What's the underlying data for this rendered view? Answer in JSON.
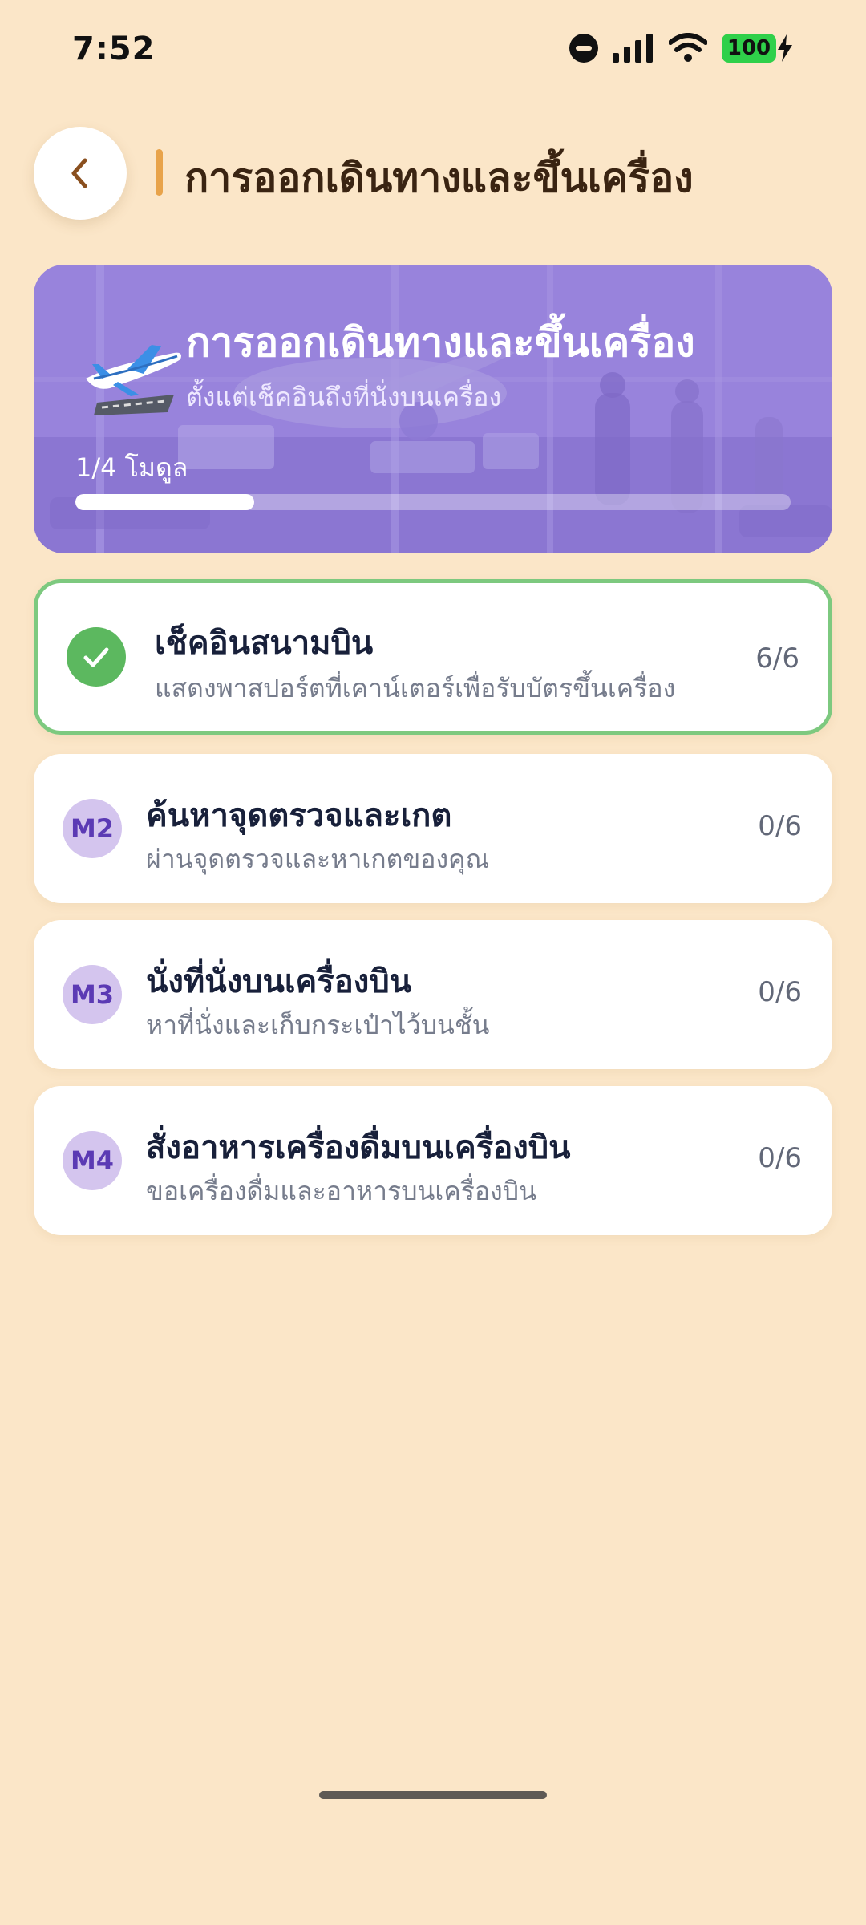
{
  "status_bar": {
    "time": "7:52",
    "battery": "100",
    "icons": [
      "do-not-disturb-icon",
      "signal-icon",
      "wifi-icon",
      "battery-icon",
      "charging-bolt-icon"
    ]
  },
  "header": {
    "back_icon": "chevron-left-icon",
    "title": "การออกเดินทางและขึ้นเครื่อง"
  },
  "hero": {
    "icon": "airplane-takeoff-icon",
    "title": "การออกเดินทางและขึ้นเครื่อง",
    "subtitle": "ตั้งแต่เช็คอินถึงที่นั่งบนเครื่อง",
    "progress_label": "1/4 โมดูล",
    "progress_fraction": 0.25
  },
  "modules": [
    {
      "badge": "",
      "badge_icon": "checkmark-icon",
      "title": "เช็คอินสนามบิน",
      "description": "แสดงพาสปอร์ตที่เคาน์เตอร์เพื่อรับบัตรขึ้นเครื่อง",
      "count": "6/6",
      "completed": true
    },
    {
      "badge": "M2",
      "title": "ค้นหาจุดตรวจและเกต",
      "description": "ผ่านจุดตรวจและหาเกตของคุณ",
      "count": "0/6",
      "completed": false
    },
    {
      "badge": "M3",
      "title": "นั่งที่นั่งบนเครื่องบิน",
      "description": "หาที่นั่งและเก็บกระเป๋าไว้บนชั้น",
      "count": "0/6",
      "completed": false
    },
    {
      "badge": "M4",
      "title": "สั่งอาหารเครื่องดื่มบนเครื่องบิน",
      "description": "ขอเครื่องดื่มและอาหารบนเครื่องบิน",
      "count": "0/6",
      "completed": false
    }
  ],
  "colors": {
    "background": "#fbe6c8",
    "accent": "#e8a34a",
    "hero_purple": "#8e77d6",
    "completed_green": "#5cb85f",
    "badge_lavender": "#d4c5ee"
  }
}
